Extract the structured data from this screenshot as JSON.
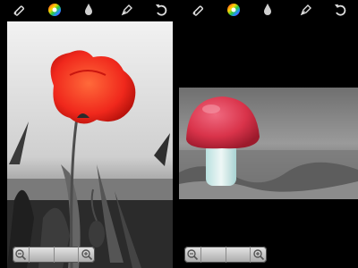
{
  "screens": [
    {
      "id": "poppy",
      "toolbar": {
        "icons": [
          "pencil-icon",
          "color-wheel-icon",
          "drop-icon",
          "pen-nib-icon",
          "undo-icon"
        ]
      },
      "photo": {
        "subject": "red-poppy-flower",
        "mode": "color-splash"
      },
      "zoom": {
        "min_icon": "zoom-out-icon",
        "max_icon": "zoom-in-icon"
      }
    },
    {
      "id": "mushroom",
      "toolbar": {
        "icons": [
          "pencil-icon",
          "color-wheel-icon",
          "drop-icon",
          "pen-nib-icon",
          "undo-icon"
        ]
      },
      "photo": {
        "subject": "red-cap-mushroom",
        "mode": "color-splash"
      },
      "zoom": {
        "min_icon": "zoom-out-icon",
        "max_icon": "zoom-in-icon"
      }
    }
  ],
  "colors": {
    "accent_red": "#e8231a",
    "mushroom_cap": "#d9334a",
    "background": "#000000",
    "toolbar_icon": "#d8d8d8"
  }
}
